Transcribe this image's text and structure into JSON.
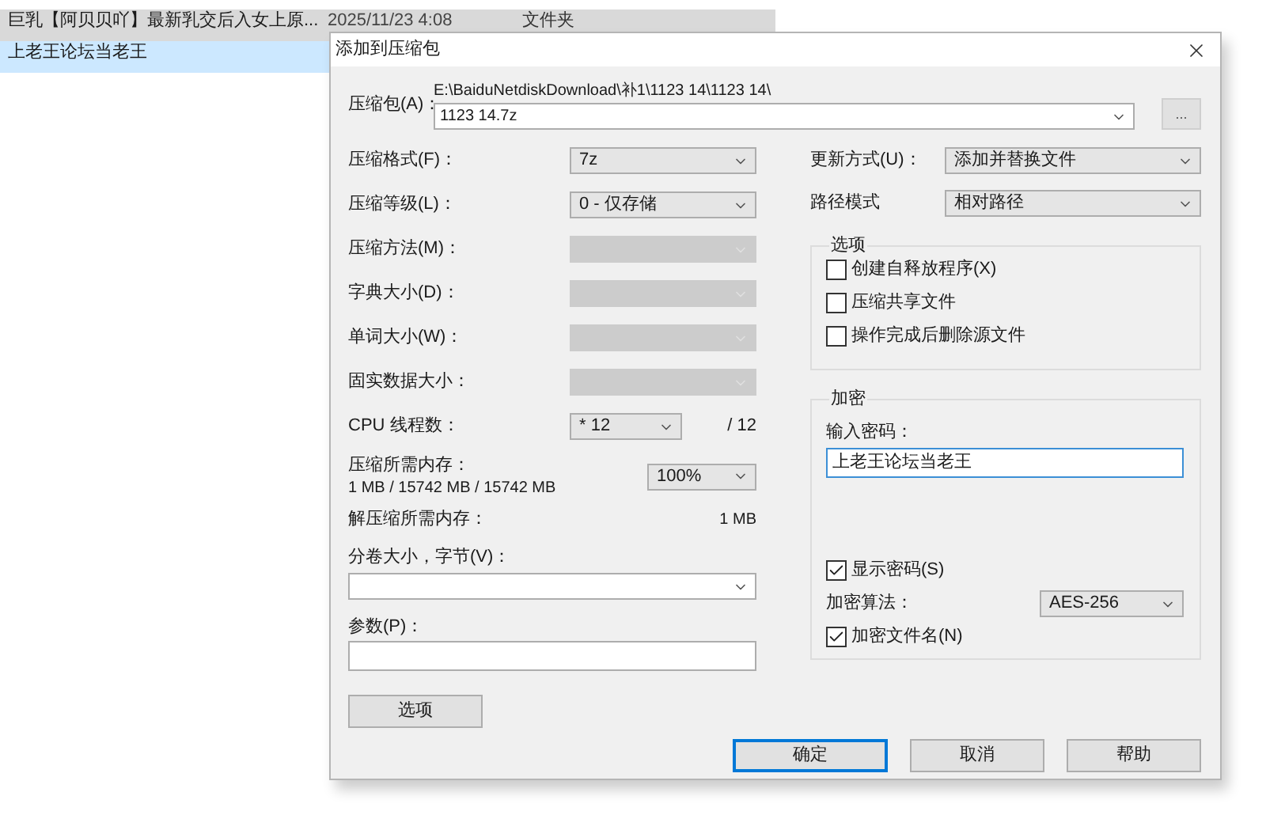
{
  "file_list": {
    "rows": [
      {
        "name": "巨乳【阿贝贝吖】最新乳交后入女上原...",
        "date": "2025/11/23 4:08",
        "type": "文件夹",
        "selected": false
      },
      {
        "name": "上老王论坛当老王",
        "selected": true
      }
    ]
  },
  "dialog": {
    "title": "添加到压缩包",
    "archive": {
      "label": "压缩包(A)：",
      "path": "E:\\BaiduNetdiskDownload\\补1\\1123 14\\1123 14\\",
      "value": "1123 14.7z",
      "browse": "..."
    },
    "left_settings": [
      {
        "label": "压缩格式(F)：",
        "value": "7z",
        "disabled": false
      },
      {
        "label": "压缩等级(L)：",
        "value": "0 - 仅存储",
        "disabled": false
      },
      {
        "label": "压缩方法(M)：",
        "disabled": true
      },
      {
        "label": "字典大小(D)：",
        "disabled": true
      },
      {
        "label": "单词大小(W)：",
        "disabled": true
      },
      {
        "label": "固实数据大小：",
        "disabled": true
      }
    ],
    "cpu": {
      "label": "CPU 线程数：",
      "value": "* 12",
      "total": "/ 12"
    },
    "memory": {
      "label": "压缩所需内存：",
      "detail": "1 MB / 15742 MB / 15742 MB",
      "value": "100%"
    },
    "decompress_memory": {
      "label": "解压缩所需内存：",
      "value": "1 MB"
    },
    "volume": {
      "label": "分卷大小，字节(V)："
    },
    "parameters": {
      "label": "参数(P)："
    },
    "options_button": "选项",
    "update_mode": {
      "label": "更新方式(U)：",
      "value": "添加并替换文件"
    },
    "path_mode": {
      "label": "路径模式",
      "value": "相对路径"
    },
    "options_group": {
      "title": "选项",
      "checkboxes": [
        {
          "label": "创建自释放程序(X)",
          "checked": false
        },
        {
          "label": "压缩共享文件",
          "checked": false
        },
        {
          "label": "操作完成后删除源文件",
          "checked": false
        }
      ]
    },
    "encryption": {
      "title": "加密",
      "password_label": "输入密码：",
      "password": "上老王论坛当老王",
      "show_password": {
        "label": "显示密码(S)",
        "checked": true
      },
      "method_label": "加密算法：",
      "method": "AES-256",
      "encrypt_names": {
        "label": "加密文件名(N)",
        "checked": true
      }
    },
    "buttons": [
      {
        "label": "确定",
        "default": true
      },
      {
        "label": "取消",
        "default": false
      },
      {
        "label": "帮助",
        "default": false
      }
    ]
  }
}
